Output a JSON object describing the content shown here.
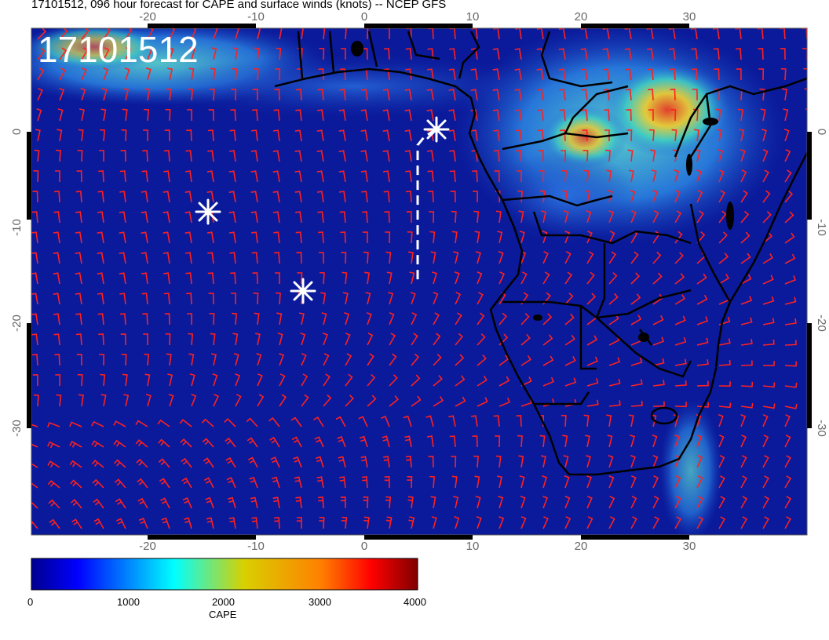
{
  "header": {
    "title": "17101512, 096 hour forecast for CAPE and surface winds (knots) -- NCEP GFS",
    "timestamp": "17101512"
  },
  "map": {
    "lon_range": [
      -31,
      41
    ],
    "lat_range": [
      -40,
      10
    ],
    "x_ticks": [
      "-20",
      "-10",
      "0",
      "10",
      "20",
      "30"
    ],
    "y_ticks": [
      "0",
      "-10",
      "-20",
      "-30"
    ],
    "background_color": "#0a1a9a",
    "wind_barb_color": "#ff2020",
    "coastline_color": "#000000",
    "markers": [
      "asterisk-1",
      "asterisk-2",
      "asterisk-3"
    ],
    "track_style": "white-dashed"
  },
  "colorbar": {
    "label": "CAPE",
    "ticks": [
      "0",
      "1000",
      "2000",
      "3000",
      "4000"
    ],
    "colormap": "jet"
  }
}
